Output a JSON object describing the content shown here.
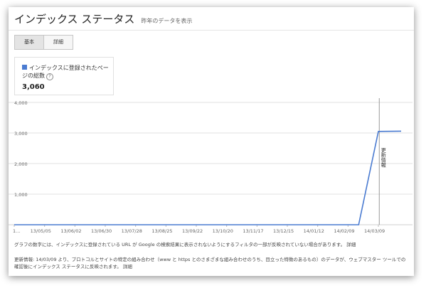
{
  "header": {
    "title": "インデックス ステータス",
    "subtitle": "昨年のデータを表示"
  },
  "tabs": [
    {
      "label": "基本",
      "active": true
    },
    {
      "label": "詳細",
      "active": false
    }
  ],
  "stat": {
    "label": "インデックスに登録されたページの総数",
    "value": "3,060",
    "color": "#4a7bd1"
  },
  "chart_data": {
    "type": "line",
    "y_ticks": [
      "4,000",
      "3,000",
      "2,000",
      "1,000"
    ],
    "ylim": [
      0,
      4000
    ],
    "x_ticks": [
      "1...",
      "13/05/05",
      "13/06/02",
      "13/06/30",
      "13/07/28",
      "13/08/25",
      "13/09/22",
      "13/10/20",
      "13/11/17",
      "13/12/15",
      "14/01/12",
      "14/02/09",
      "14/03/09"
    ],
    "series": [
      {
        "color": "#4a7bd1",
        "x": [
          0,
          11.35,
          12.0,
          12.75
        ],
        "values": [
          0,
          0,
          3050,
          3060
        ]
      }
    ],
    "annotation": {
      "label": "更新情報",
      "x": 12.03
    }
  },
  "footer": {
    "note1": "グラフの数字には、インデックスに登録されている URL が Google の検索結果に表示されないようにするフィルタの一部が反映されていない場合があります。",
    "note1_link": "詳細",
    "note2": "更新情報: 14/03/09 より、プロトコルとサイトの特定の組み合わせ（www と https とのさまざまな組み合わせのうち、目立った特徴のあるもの）のデータが、ウェブマスター ツールでの確認後にインデックス ステータスに反映されます。",
    "note2_link": "詳細"
  }
}
